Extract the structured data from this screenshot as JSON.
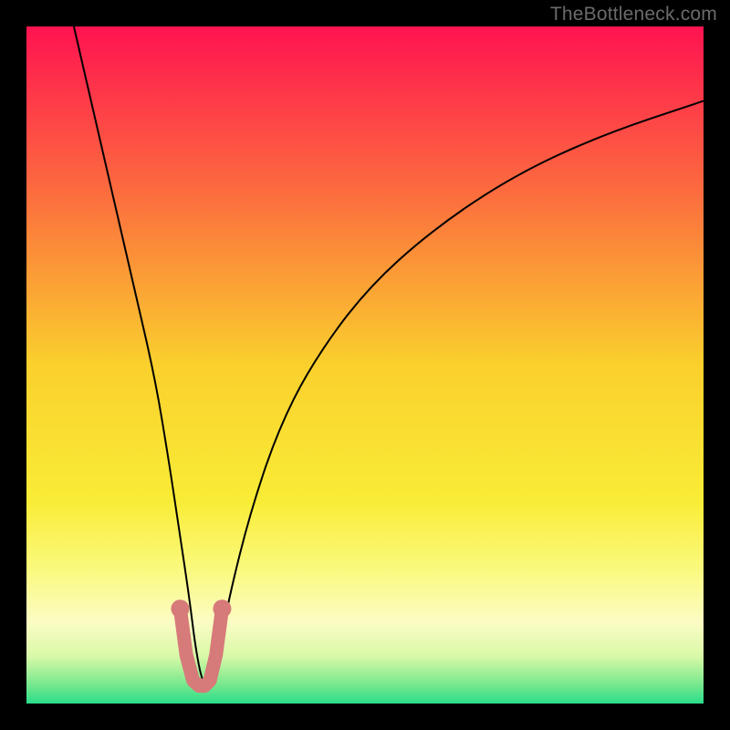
{
  "watermark": "TheBottleneck.com",
  "chart_data": {
    "type": "line",
    "title": "",
    "xlabel": "",
    "ylabel": "",
    "xlim": [
      0,
      100
    ],
    "ylim": [
      0,
      100
    ],
    "gradient_stops": [
      {
        "offset": 0.0,
        "color": "#ff1350"
      },
      {
        "offset": 0.25,
        "color": "#fc6e3e"
      },
      {
        "offset": 0.5,
        "color": "#fad02d"
      },
      {
        "offset": 0.7,
        "color": "#f9ec36"
      },
      {
        "offset": 0.8,
        "color": "#faf97c"
      },
      {
        "offset": 0.88,
        "color": "#fbfcc4"
      },
      {
        "offset": 0.93,
        "color": "#d9f9a8"
      },
      {
        "offset": 0.97,
        "color": "#7ce98e"
      },
      {
        "offset": 1.0,
        "color": "#2bdd8a"
      }
    ],
    "series": [
      {
        "name": "bottleneck-curve",
        "x": [
          7,
          10,
          13,
          16,
          19,
          21,
          22.5,
          24,
          25,
          26,
          27,
          28.5,
          30,
          33,
          37,
          42,
          50,
          60,
          72,
          85,
          100
        ],
        "y": [
          100,
          87,
          74,
          61,
          48,
          36,
          26,
          16,
          8,
          3,
          3,
          8,
          16,
          28,
          40,
          50,
          61,
          70,
          78,
          84,
          89
        ]
      }
    ],
    "highlight": {
      "name": "optimal-region",
      "color": "#d77a7a",
      "x": [
        22.7,
        23.6,
        24.6,
        25.5,
        26.3,
        27.1,
        28.0,
        28.9
      ],
      "y": [
        14.0,
        7.2,
        3.4,
        2.6,
        2.6,
        3.4,
        7.2,
        14.0
      ]
    }
  }
}
